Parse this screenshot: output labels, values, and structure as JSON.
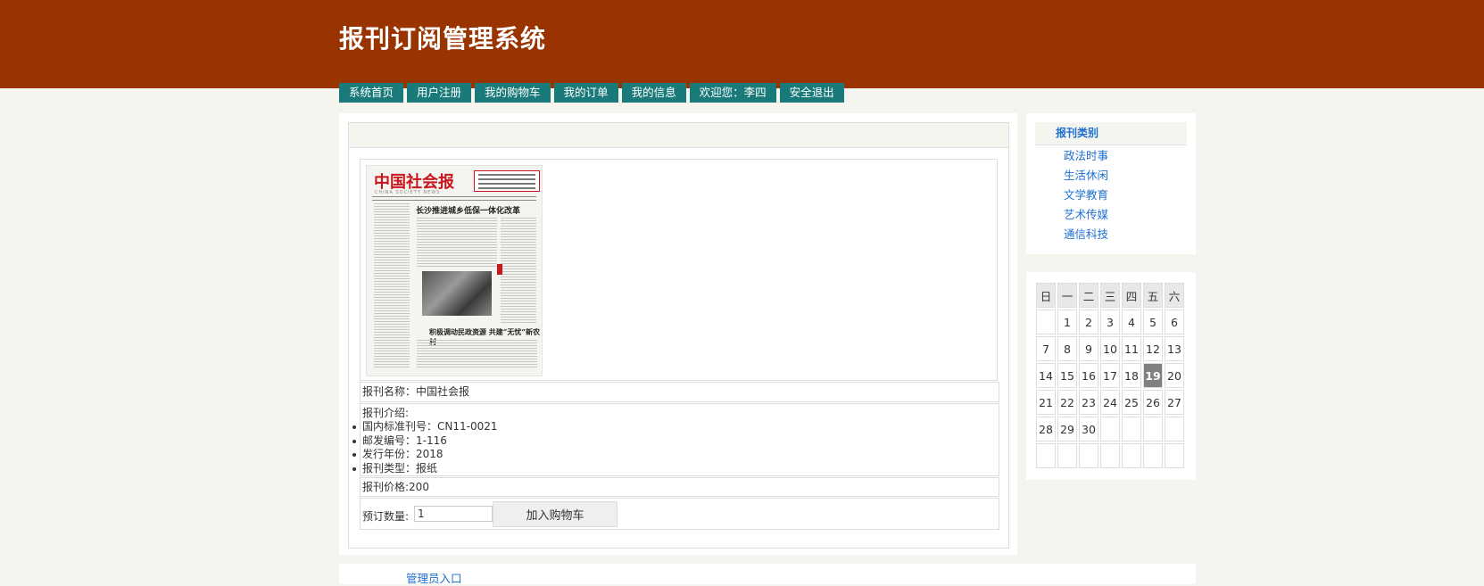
{
  "site": {
    "title": "报刊订阅管理系统"
  },
  "nav": [
    {
      "label": "系统首页"
    },
    {
      "label": "用户注册"
    },
    {
      "label": "我的购物车"
    },
    {
      "label": "我的订单"
    },
    {
      "label": "我的信息"
    },
    {
      "label": "欢迎您：李四"
    },
    {
      "label": "安全退出"
    }
  ],
  "product": {
    "image": {
      "masthead": "中国社会报",
      "masthead_sub": "CHINA SOCIETY NEWS",
      "headline": "长沙推进城乡低保一体化改革",
      "headline2": "积极调动民政资源  共建“无忧”新农村"
    },
    "name_line": "报刊名称：中国社会报",
    "intro_label": "报刊介绍:",
    "intro_items": [
      "国内标准刊号：CN11-0021",
      "邮发编号：1-116",
      "发行年份：2018",
      "报刊类型：报纸"
    ],
    "price_line": "报刊价格:200",
    "order_label": "预订数量:",
    "quantity": "1",
    "add_to_cart": "加入购物车"
  },
  "categories": {
    "title": "报刊类别",
    "items": [
      "政法时事",
      "生活休闲",
      "文学教育",
      "艺术传媒",
      "通信科技"
    ]
  },
  "calendar": {
    "weekdays": [
      "日",
      "一",
      "二",
      "三",
      "四",
      "五",
      "六"
    ],
    "weeks": [
      [
        "",
        "1",
        "2",
        "3",
        "4",
        "5",
        "6"
      ],
      [
        "7",
        "8",
        "9",
        "10",
        "11",
        "12",
        "13"
      ],
      [
        "14",
        "15",
        "16",
        "17",
        "18",
        "19",
        "20"
      ],
      [
        "21",
        "22",
        "23",
        "24",
        "25",
        "26",
        "27"
      ],
      [
        "28",
        "29",
        "30",
        "",
        "",
        "",
        ""
      ],
      [
        "",
        "",
        "",
        "",
        "",
        "",
        ""
      ]
    ],
    "today": "19",
    "today_color": "#808080"
  },
  "footer": {
    "admin_link": "管理员入口"
  },
  "colors": {
    "header": "#993300",
    "nav": "#1a7a7a",
    "link": "#1e6fd0",
    "background": "#f5f5f0"
  }
}
